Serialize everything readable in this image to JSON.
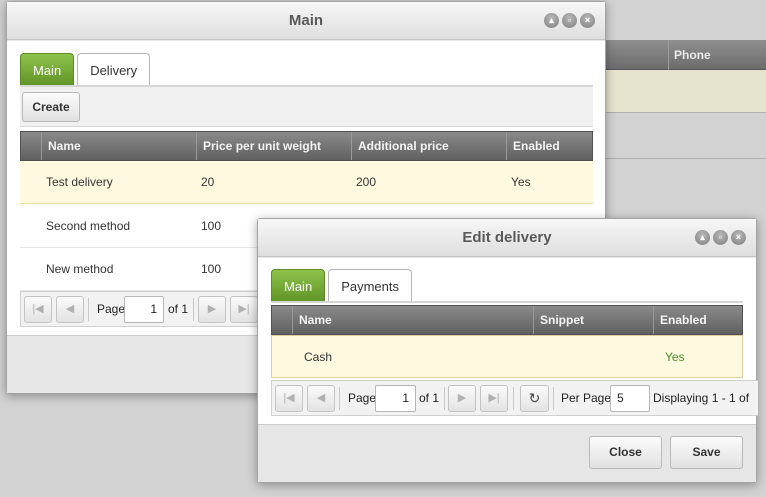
{
  "background": {
    "phone_header": "Phone"
  },
  "main_window": {
    "title": "Main",
    "tabs": [
      {
        "label": "Main",
        "active": true
      },
      {
        "label": "Delivery",
        "active": false
      }
    ],
    "create_label": "Create",
    "columns": [
      "Name",
      "Price per unit weight",
      "Additional price",
      "Enabled"
    ],
    "rows": [
      {
        "name": "Test delivery",
        "price": "20",
        "additional": "200",
        "enabled": "Yes"
      },
      {
        "name": "Second method",
        "price": "100",
        "additional": "",
        "enabled": ""
      },
      {
        "name": "New method",
        "price": "100",
        "additional": "",
        "enabled": ""
      }
    ],
    "pager": {
      "page_label": "Page",
      "page_value": "1",
      "of_label": "of 1"
    }
  },
  "edit_window": {
    "title": "Edit delivery",
    "tabs": [
      {
        "label": "Main",
        "active": true
      },
      {
        "label": "Payments",
        "active": false
      }
    ],
    "columns": [
      "Name",
      "Snippet",
      "Enabled"
    ],
    "rows": [
      {
        "name": "Cash",
        "snippet": "",
        "enabled": "Yes"
      }
    ],
    "pager": {
      "page_label": "Page",
      "page_value": "1",
      "of_label": "of 1",
      "per_page_label": "Per Page:",
      "per_page_value": "5",
      "displaying": "Displaying 1 - 1 of"
    },
    "close_label": "Close",
    "save_label": "Save",
    "enabled_color": "#3f8f1a"
  },
  "colors": {
    "tab_active": "#6fa532",
    "grid_header": "#707070",
    "row_selected": "#fff9e0"
  },
  "icons": {
    "window_tools": [
      "collapse-icon",
      "maximize-icon",
      "close-icon"
    ],
    "pager": [
      "first-page-icon",
      "prev-page-icon",
      "next-page-icon",
      "last-page-icon",
      "refresh-icon"
    ]
  }
}
